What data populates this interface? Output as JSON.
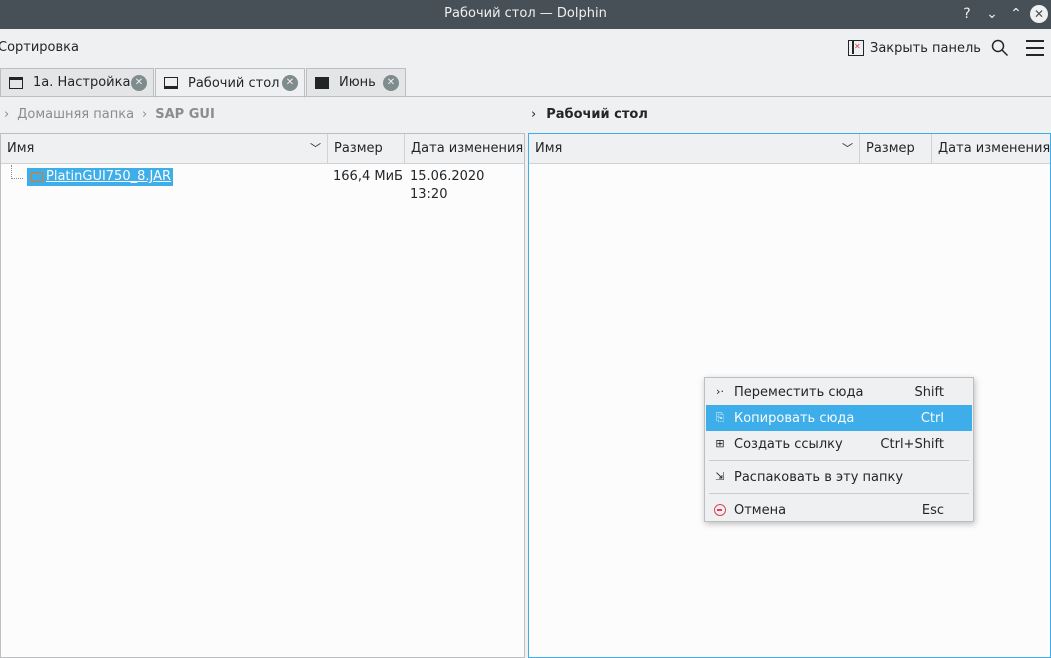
{
  "window": {
    "title": "Рабочий стол — Dolphin",
    "help_glyph": "?",
    "minimize_glyph": "⌄",
    "maximize_glyph": "⌃",
    "close_glyph": "✕"
  },
  "toolbar": {
    "sort_label": "Сортировка",
    "close_panel_label": "Закрыть панель",
    "search_icon": "search-icon",
    "menu_icon": "hamburger-menu-icon"
  },
  "tabs": [
    {
      "label": "1а. Настройка",
      "icon": "folder-icon",
      "active": false
    },
    {
      "label": "Рабочий стол",
      "icon": "desktop-icon",
      "active": true
    },
    {
      "label": "Июнь",
      "icon": "drive-icon",
      "active": false
    }
  ],
  "tab_close_glyph": "✕",
  "left_panel": {
    "breadcrumb": [
      "Домашняя папка",
      "SAP GUI"
    ],
    "columns": {
      "name": "Имя",
      "size": "Размер",
      "date": "Дата изменения"
    },
    "files": [
      {
        "name": "PlatinGUI750_8.JAR",
        "size": "166,4 МиБ",
        "modified": "15.06.2020 13:20",
        "selected": true
      }
    ]
  },
  "right_panel": {
    "breadcrumb": [
      "Рабочий стол"
    ],
    "columns": {
      "name": "Имя",
      "size": "Размер",
      "date": "Дата изменения"
    }
  },
  "context_menu": {
    "items": [
      {
        "label": "Переместить сюда",
        "shortcut": "Shift",
        "icon": "move-icon",
        "highlighted": false
      },
      {
        "label": "Копировать сюда",
        "shortcut": "Ctrl",
        "icon": "copy-icon",
        "highlighted": true
      },
      {
        "label": "Создать ссылку",
        "shortcut": "Ctrl+Shift",
        "icon": "link-icon",
        "highlighted": false
      },
      {
        "label": "Распаковать в эту папку",
        "shortcut": "",
        "icon": "extract-icon",
        "highlighted": false
      },
      {
        "label": "Отмена",
        "shortcut": "Esc",
        "icon": "cancel-icon",
        "highlighted": false
      }
    ]
  },
  "colors": {
    "accent": "#3daee9",
    "titlebar": "#475057",
    "window_bg": "#eff0f1"
  }
}
